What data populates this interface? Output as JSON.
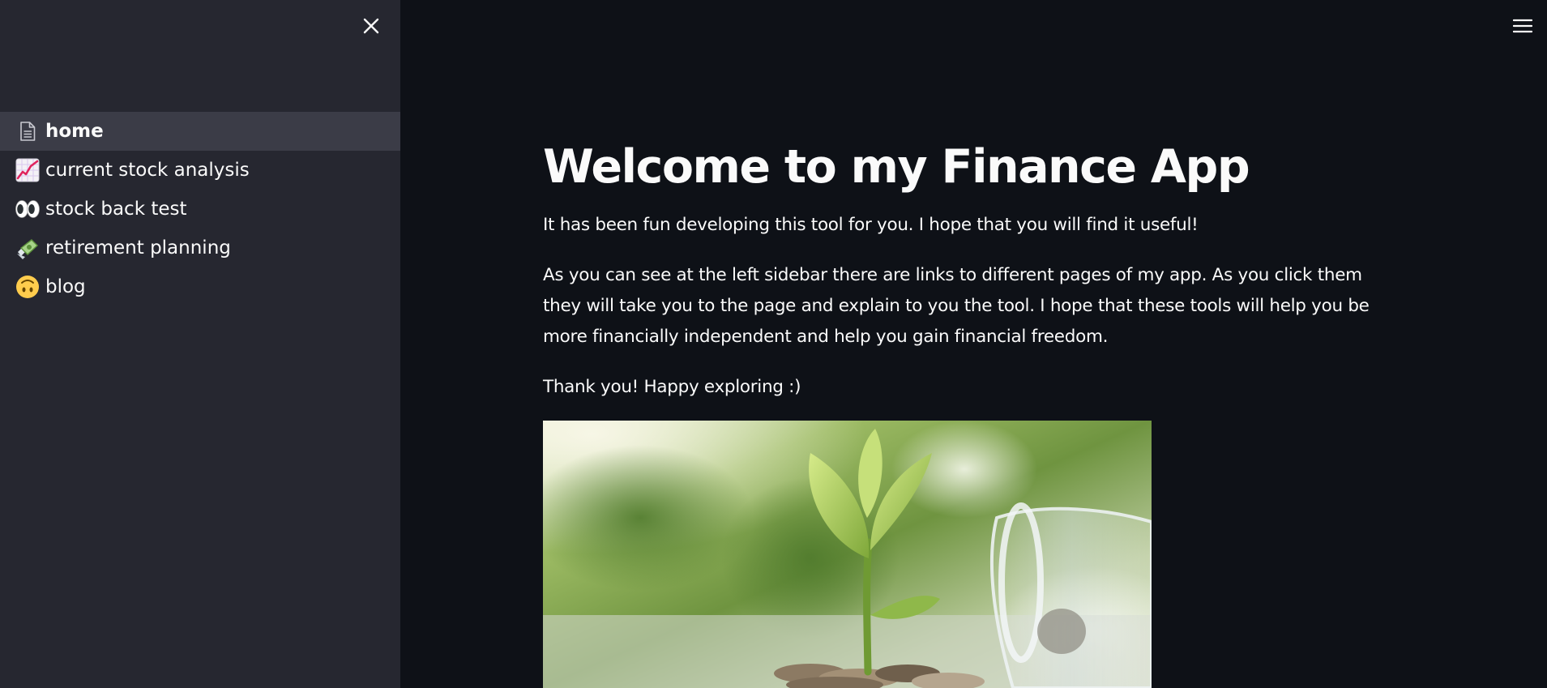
{
  "sidebar": {
    "close_icon": "close-icon",
    "items": [
      {
        "label": "home",
        "icon": "page-icon",
        "active": true
      },
      {
        "label": "current stock analysis",
        "icon": "chart-increasing-emoji"
      },
      {
        "label": "stock back test",
        "icon": "eyes-emoji"
      },
      {
        "label": "retirement planning",
        "icon": "money-with-wings-emoji"
      },
      {
        "label": "blog",
        "icon": "upside-down-face-emoji"
      }
    ]
  },
  "header": {
    "menu_icon": "hamburger-menu-icon"
  },
  "main": {
    "title": "Welcome to my Finance App",
    "paragraphs": [
      "It has been fun developing this tool for you. I hope that you will find it useful!",
      "As you can see at the left sidebar there are links to different pages of my app. As you click them they will take you to the page and explain to you the tool. I hope that these tools will help you be more financially independent and help you gain financial freedom.",
      "Thank you! Happy exploring :)"
    ],
    "image": "plant-sprouting-from-coins-and-glass-jar"
  },
  "colors": {
    "background": "#0e1117",
    "sidebar": "#262730",
    "active_item": "#3b3c47",
    "text": "#fafafa"
  }
}
